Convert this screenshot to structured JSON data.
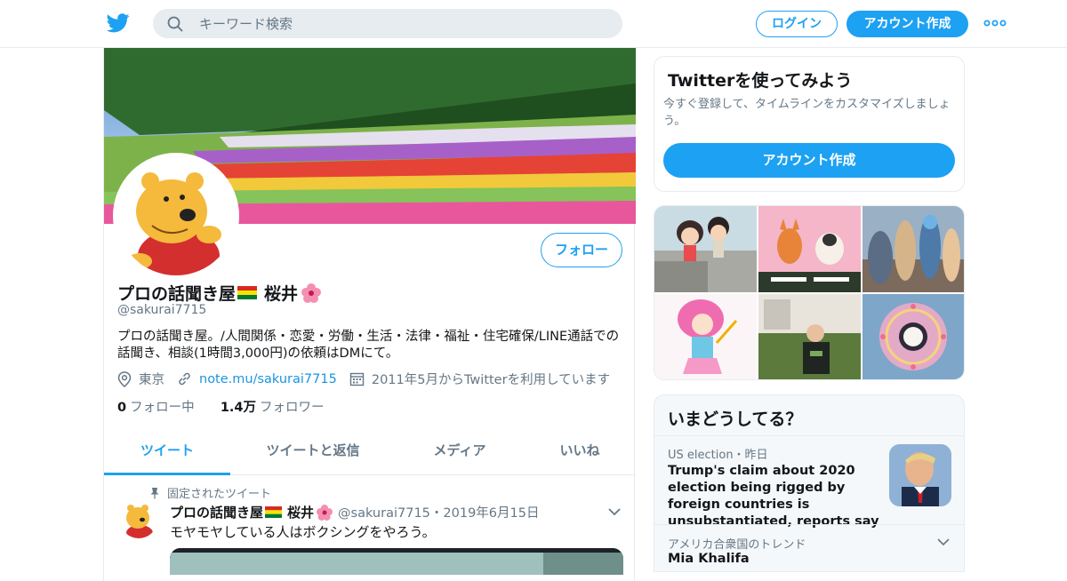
{
  "header": {
    "search_placeholder": "キーワード検索",
    "login_label": "ログイン",
    "signup_label": "アカウント作成"
  },
  "profile": {
    "display_name": "プロの話聞き屋",
    "display_name_suffix": "桜井",
    "handle": "@sakurai7715",
    "follow_label": "フォロー",
    "bio": "プロの話聞き屋。/人間関係・恋愛・労働・生活・法律・福祉・住宅確保/LINE通話での話聞き、相談(1時間3,000円)の依頼はDMにて。",
    "location": "東京",
    "website": "note.mu/sakurai7715",
    "joined": "2011年5月からTwitterを利用しています",
    "following_count": "0",
    "following_label": "フォロー中",
    "followers_count": "1.4万",
    "followers_label": "フォロワー"
  },
  "tabs": [
    {
      "label": "ツイート",
      "active": true
    },
    {
      "label": "ツイートと返信",
      "active": false
    },
    {
      "label": "メディア",
      "active": false
    },
    {
      "label": "いいね",
      "active": false
    }
  ],
  "pinned_tweet": {
    "pin_label": "固定されたツイート",
    "author_name": "プロの話聞き屋",
    "author_suffix": "桜井",
    "meta": "@sakurai7715・2019年6月15日",
    "text": "モヤモヤしている人はボクシングをやろう。"
  },
  "signup_card": {
    "title": "Twitterを使ってみよう",
    "subtitle": "今すぐ登録して、タイムラインをカスタマイズしましょう。",
    "button_label": "アカウント作成"
  },
  "trends": {
    "title": "いまどうしてる？",
    "news_category": "US election・昨日",
    "news_title": "Trump's claim about 2020 election being rigged by foreign countries is unsubstantiated, reports say",
    "trend_category": "アメリカ合衆国のトレンド",
    "trend_name": "Mia Khalifa"
  },
  "colors": {
    "brand": "#1da1f2",
    "link": "#1b95e0",
    "text": "#14171a",
    "secondary": "#657786"
  }
}
